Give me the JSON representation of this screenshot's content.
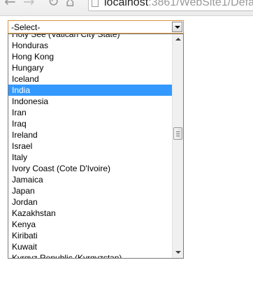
{
  "browser": {
    "url_host": "localhost",
    "url_rest": ":3861/WebSite1/Defa"
  },
  "select": {
    "current_value": "-Select-"
  },
  "dropdown": {
    "options": [
      "Holy See (Vatican City State)",
      "Honduras",
      "Hong Kong",
      "Hungary",
      "Iceland",
      "India",
      "Indonesia",
      "Iran",
      "Iraq",
      "Ireland",
      "Israel",
      "Italy",
      "Ivory Coast (Cote D'Ivoire)",
      "Jamaica",
      "Japan",
      "Jordan",
      "Kazakhstan",
      "Kenya",
      "Kiribati",
      "Kuwait",
      "Kyrgyz Republic (Kyrgyzstan)"
    ],
    "highlighted": "India"
  },
  "colors": {
    "highlight": "#3399ff",
    "focus_border": "#d8923f"
  }
}
